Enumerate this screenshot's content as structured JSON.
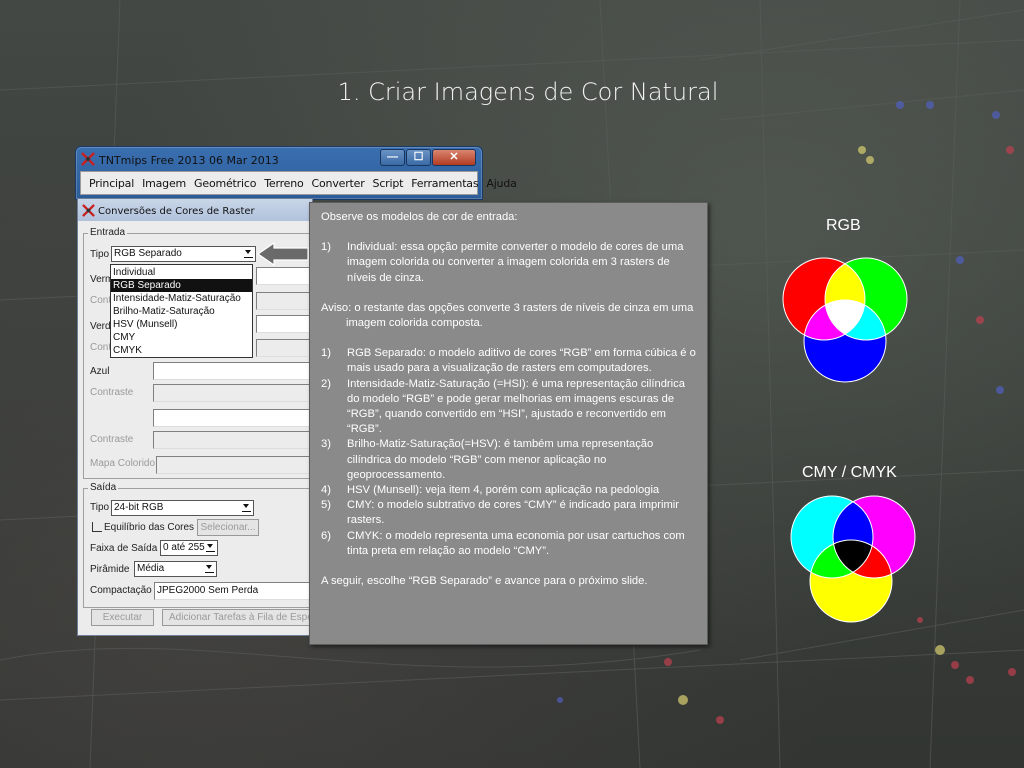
{
  "slide": {
    "title": "1. Criar Imagens de Cor Natural"
  },
  "main_window": {
    "title": "TNTmips Free 2013    06 Mar 2013",
    "buttons": {
      "minimize": "—",
      "maximize": "☐",
      "close": "✕"
    },
    "menu": [
      "Principal",
      "Imagem",
      "Geométrico",
      "Terreno",
      "Converter",
      "Script",
      "Ferramentas",
      "Ajuda"
    ]
  },
  "dialog": {
    "title": "Conversões de Cores de Raster",
    "input_group": "Entrada",
    "type_label": "Tipo",
    "type_value": "RGB Separado",
    "type_options": [
      "Individual",
      "RGB Separado",
      "Intensidade-Matiz-Saturação",
      "Brilho-Matiz-Saturação",
      "HSV (Munsell)",
      "CMY",
      "CMYK"
    ],
    "type_selected_index": 1,
    "verm_label": "Verm",
    "contr_short": "Contr",
    "verd_label": "Verd",
    "azul_label": "Azul",
    "contraste_label": "Contraste",
    "mapa_colorido_label": "Mapa Colorido",
    "output_group": "Saída",
    "out_type_value": "24-bit RGB",
    "equilibrio_label": "Equilíbrio das Cores",
    "selecionar_button": "Selecionar...",
    "faixa_label": "Faixa de Saída",
    "faixa_value": "0 até 255",
    "piramide_label": "Pirâmide",
    "piramide_value": "Média",
    "compactacao_label": "Compactação",
    "compactacao_value": "JPEG2000 Sem Perda",
    "executar_button": "Executar",
    "adicionar_button": "Adicionar Tarefas à Fila de Espe"
  },
  "note": {
    "intro": "Observe os modelos de cor de entrada:",
    "item_individual": "Individual: essa opção permite converter o modelo de cores de uma imagem colorida ou converter a imagem colorida em 3 rasters de níveis de cinza.",
    "aviso": "Aviso: o restante das opções converte 3 rasters de níveis de cinza em uma imagem colorida composta.",
    "items": [
      {
        "n": "1)",
        "text": "RGB Separado: o modelo aditivo de cores “RGB” em forma cúbica é o mais usado para a visualização de rasters em computadores."
      },
      {
        "n": "2)",
        "text": "Intensidade-Matiz-Saturação (=HSI): é uma representação cilíndrica do modelo “RGB” e pode gerar melhorias em imagens escuras de “RGB”, quando convertido em “HSI”, ajustado e reconvertido em “RGB”."
      },
      {
        "n": "3)",
        "text": "Brilho-Matiz-Saturação(=HSV): é também uma representação cilíndrica do modelo “RGB” com menor aplicação no geoprocessamento."
      },
      {
        "n": "4)",
        "text": "HSV (Munsell): veja item 4, porém com aplicação na pedologia"
      },
      {
        "n": "5)",
        "text": "CMY: o modelo subtrativo de cores “CMY” é indicado para imprimir rasters."
      },
      {
        "n": "6)",
        "text": "CMYK: o modelo representa uma economia por usar cartuchos com tinta preta em relação ao modelo “CMY”."
      }
    ],
    "first_number": "1)",
    "footer": "A seguir, escolhe “RGB Separado” e avance para o próximo slide."
  },
  "diagrams": {
    "rgb_caption": "RGB",
    "cmy_caption": "CMY / CMYK",
    "colors": {
      "red": "#ff0000",
      "green": "#00ff00",
      "blue": "#0000ff",
      "cyan": "#00ffff",
      "magenta": "#ff00ff",
      "yellow": "#ffff00",
      "white": "#ffffff",
      "black": "#000000"
    }
  }
}
